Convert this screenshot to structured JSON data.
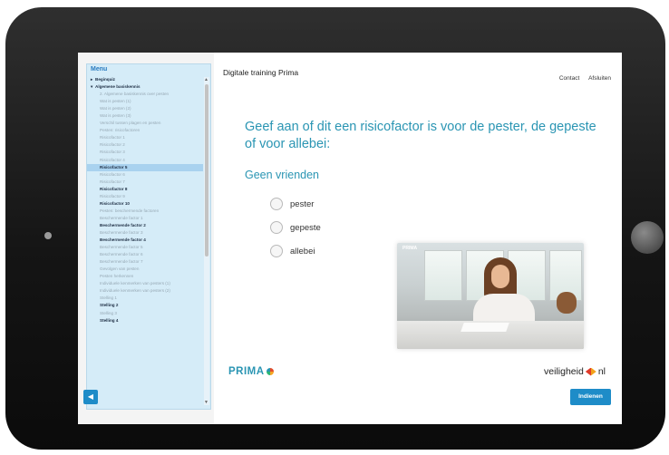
{
  "menu": {
    "title": "Menu",
    "items": [
      {
        "label": "Beginquiz",
        "level": 0,
        "caret": "▸"
      },
      {
        "label": "Algemene basiskennis",
        "level": 0,
        "caret": "▾"
      },
      {
        "label": "2. Algemene basiskennis over pesten",
        "level": 1
      },
      {
        "label": "Wat is pesten (1)",
        "level": 1
      },
      {
        "label": "Wat is pesten (2)",
        "level": 1
      },
      {
        "label": "Wat is pesten (3)",
        "level": 1
      },
      {
        "label": "Verschil tussen plagen en pesten",
        "level": 1
      },
      {
        "label": "Pesten: risicofactoren",
        "level": 1
      },
      {
        "label": "Risicofactor 1",
        "level": 1
      },
      {
        "label": "Risicofactor 2",
        "level": 1
      },
      {
        "label": "Risicofactor 3",
        "level": 1
      },
      {
        "label": "Risicofactor 4",
        "level": 1
      },
      {
        "label": "Risicofactor 5",
        "level": 1,
        "bold": true,
        "active": true
      },
      {
        "label": "Risicofactor 6",
        "level": 1
      },
      {
        "label": "Risicofactor 7",
        "level": 1
      },
      {
        "label": "Risicofactor 8",
        "level": 1,
        "bold": true
      },
      {
        "label": "Risicofactor 9",
        "level": 1
      },
      {
        "label": "Risicofactor 10",
        "level": 1,
        "bold": true
      },
      {
        "label": "Pesten: beschermende factoren",
        "level": 1
      },
      {
        "label": "Beschermende factor 1",
        "level": 1
      },
      {
        "label": "Beschermende factor 2",
        "level": 1,
        "bold": true
      },
      {
        "label": "Beschermende factor 3",
        "level": 1
      },
      {
        "label": "Beschermende factor 4",
        "level": 1,
        "bold": true
      },
      {
        "label": "Beschermende factor 5",
        "level": 1
      },
      {
        "label": "Beschermende factor 6",
        "level": 1
      },
      {
        "label": "Beschermende factor 7",
        "level": 1
      },
      {
        "label": "Gevolgen van pesten",
        "level": 1
      },
      {
        "label": "Pesten herkennen",
        "level": 1
      },
      {
        "label": "Individuele kenmerken van pesters (1)",
        "level": 1
      },
      {
        "label": "Individuele kenmerken van pesters (2)",
        "level": 1
      },
      {
        "label": "Stelling 1",
        "level": 1
      },
      {
        "label": "Stelling 2",
        "level": 1,
        "bold": true
      },
      {
        "label": "Stelling 3",
        "level": 1
      },
      {
        "label": "Stelling 4",
        "level": 1,
        "bold": true
      }
    ]
  },
  "header": {
    "title": "Digitale training Prima",
    "links": [
      "Contact",
      "Afsluiten"
    ]
  },
  "question": {
    "text": "Geef aan of dit een risicofactor is voor de pester, de gepeste of voor allebei:",
    "statement": "Geen vrienden",
    "options": [
      "pester",
      "gepeste",
      "allebei"
    ]
  },
  "photo": {
    "watermark": "PRIMA"
  },
  "footer": {
    "prima_logo": "PRIMA",
    "vh_logo_left": "veiligheid",
    "vh_logo_right": "nl",
    "submit_label": "Indienen",
    "audio_icon": "speaker-icon"
  },
  "colors": {
    "accent": "#2a95b3",
    "button": "#1e8cc8",
    "sidebar": "#d5ecf8"
  }
}
